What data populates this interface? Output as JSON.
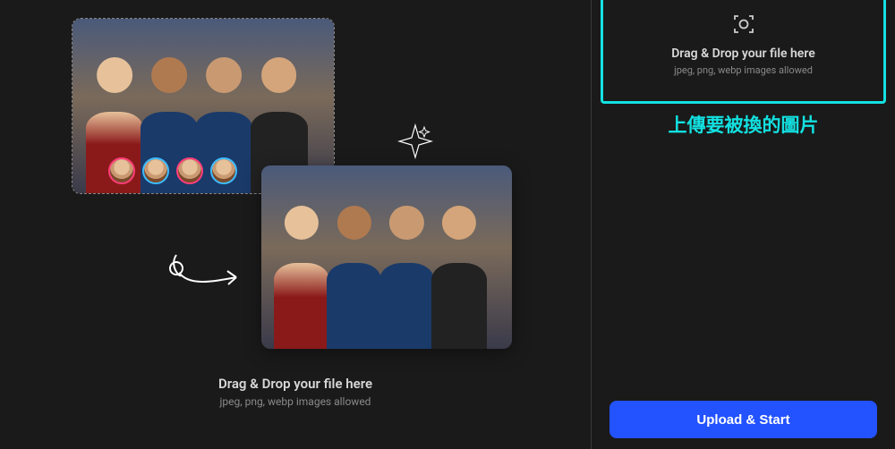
{
  "left": {
    "drop": {
      "title": "Drag & Drop your file here",
      "subtitle": "jpeg, png, webp images allowed"
    }
  },
  "right": {
    "upload": {
      "title": "Drag & Drop your file here",
      "subtitle": "jpeg, png, webp images allowed"
    },
    "annotation": "上傳要被換的圖片",
    "start_button": "Upload & Start"
  },
  "accent": {
    "highlight": "#13e0e0",
    "primary": "#2352ff"
  }
}
